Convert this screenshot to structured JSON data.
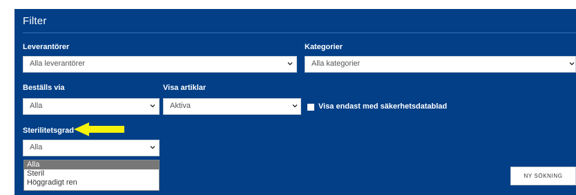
{
  "filter": {
    "title": "Filter",
    "suppliers": {
      "label": "Leverantörer",
      "value": "Alla leverantörer"
    },
    "categories": {
      "label": "Kategorier",
      "value": "Alla kategorier"
    },
    "order_via": {
      "label": "Beställs via",
      "value": "Alla"
    },
    "show_articles": {
      "label": "Visa artiklar",
      "value": "Aktiva"
    },
    "safety_data_sheet": {
      "label": "Visa endast med säkerhetsdatablad",
      "checked": false
    },
    "sterility": {
      "label": "Sterilitetsgrad",
      "value": "Alla",
      "options": [
        "Alla",
        "Steril",
        "Höggradigt ren"
      ],
      "selected_index": 0
    },
    "new_search_label": "NY SÖKNING"
  },
  "colors": {
    "panel_background": "#023f87",
    "annotation_arrow": "#f6f20a"
  },
  "icons": [
    "chevron-down-icon",
    "yellow-arrow-annotation"
  ]
}
